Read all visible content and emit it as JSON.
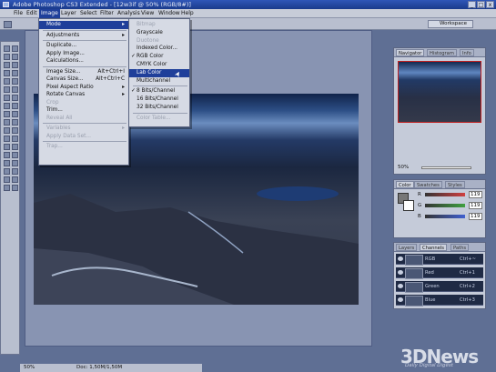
{
  "window": {
    "title": "Adobe Photoshop CS3 Extended - [12w3if @ 50% (RGB/8#)]",
    "min": "_",
    "max": "□",
    "close": "x"
  },
  "menubar": [
    "File",
    "Edit",
    "Image",
    "Layer",
    "Select",
    "Filter",
    "Analysis",
    "View",
    "Window",
    "Help"
  ],
  "options": {
    "workspace": "Workspace"
  },
  "image_menu": [
    {
      "label": "Mode",
      "state": "highlight"
    },
    {
      "sep": true
    },
    {
      "label": "Adjustments"
    },
    {
      "sep": true
    },
    {
      "label": "Duplicate..."
    },
    {
      "label": "Apply Image..."
    },
    {
      "label": "Calculations..."
    },
    {
      "sep": true
    },
    {
      "label": "Image Size...",
      "shortcut": "Alt+Ctrl+I"
    },
    {
      "label": "Canvas Size...",
      "shortcut": "Alt+Ctrl+C"
    },
    {
      "label": "Pixel Aspect Ratio"
    },
    {
      "label": "Rotate Canvas"
    },
    {
      "label": "Crop",
      "state": "disabled"
    },
    {
      "label": "Trim..."
    },
    {
      "label": "Reveal All",
      "state": "disabled"
    },
    {
      "sep": true
    },
    {
      "label": "Variables",
      "state": "disabled"
    },
    {
      "label": "Apply Data Set...",
      "state": "disabled"
    },
    {
      "sep": true
    },
    {
      "label": "Trap...",
      "state": "disabled"
    }
  ],
  "mode_menu": [
    {
      "label": "Bitmap",
      "state": "disabled"
    },
    {
      "label": "Grayscale"
    },
    {
      "label": "Duotone",
      "state": "disabled"
    },
    {
      "label": "Indexed Color..."
    },
    {
      "label": "RGB Color",
      "checked": true
    },
    {
      "label": "CMYK Color"
    },
    {
      "label": "Lab Color",
      "state": "highlight"
    },
    {
      "label": "Multichannel"
    },
    {
      "sep": true
    },
    {
      "label": "8 Bits/Channel",
      "checked": true
    },
    {
      "label": "16 Bits/Channel"
    },
    {
      "label": "32 Bits/Channel"
    },
    {
      "sep": true
    },
    {
      "label": "Color Table...",
      "state": "disabled"
    }
  ],
  "navigator": {
    "tabs": [
      "Navigator",
      "Histogram",
      "Info"
    ],
    "zoom": "50%"
  },
  "color": {
    "tabs": [
      "Color",
      "Swatches",
      "Styles"
    ],
    "channels": [
      {
        "l": "R",
        "v": "119"
      },
      {
        "l": "G",
        "v": "119"
      },
      {
        "l": "B",
        "v": "119"
      }
    ]
  },
  "channels_panel": {
    "tabs": [
      "Layers",
      "Channels",
      "Paths"
    ],
    "rows": [
      {
        "name": "RGB",
        "key": "Ctrl+~"
      },
      {
        "name": "Red",
        "key": "Ctrl+1"
      },
      {
        "name": "Green",
        "key": "Ctrl+2"
      },
      {
        "name": "Blue",
        "key": "Ctrl+3"
      }
    ]
  },
  "status": {
    "zoom": "50%",
    "doc": "Doc: 1,50M/1,50M"
  },
  "watermark": {
    "text": "3DNews",
    "sub": "Daily Digital Digest"
  },
  "colors": {
    "accent": "#1f3f9a",
    "workspace": "#5f6f94"
  }
}
